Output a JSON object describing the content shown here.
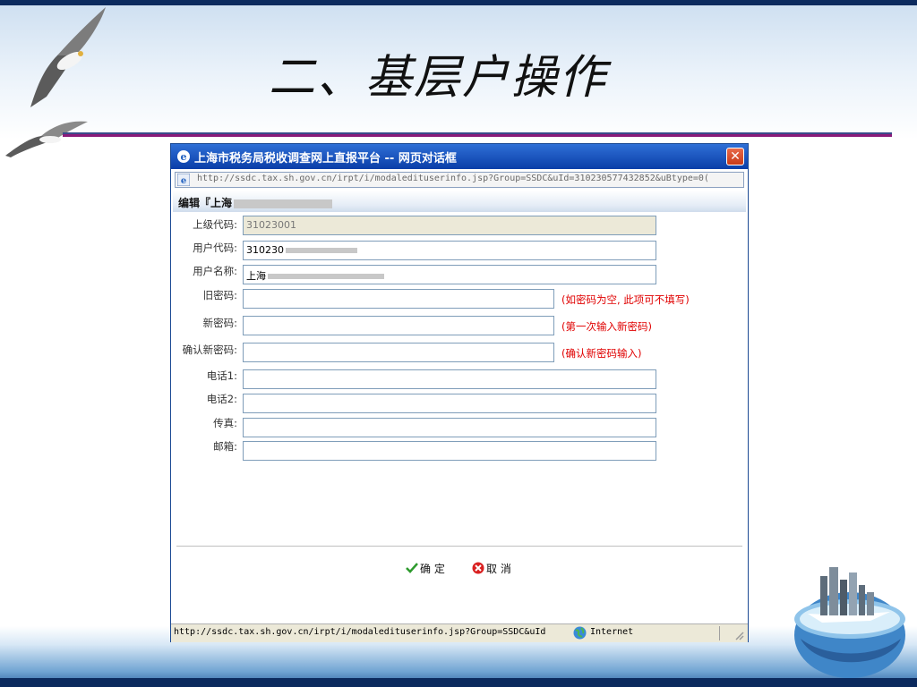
{
  "slide": {
    "title": "二、基层户操作"
  },
  "dialog": {
    "title": "上海市税务局税收调查网上直报平台 -- 网页对话框",
    "close_glyph": "✕",
    "address": "http://ssdc.tax.sh.gov.cn/irpt/i/modaledituserinfo.jsp?Group=SSDC&uId=310230577432852&uBtype=0(",
    "section_title": "编辑『上海",
    "fields": [
      {
        "label": "上级代码:",
        "value": "31023001",
        "readonly": true
      },
      {
        "label": "用户代码:",
        "value": "310230",
        "readonly": false
      },
      {
        "label": "用户名称:",
        "value": "上海",
        "readonly": false
      },
      {
        "label": "旧密码:",
        "value": "",
        "hint": "(如密码为空, 此项可不填写)"
      },
      {
        "label": "新密码:",
        "value": "",
        "hint": "(第一次输入新密码)"
      },
      {
        "label": "确认新密码:",
        "value": "",
        "hint": "(确认新密码输入)"
      },
      {
        "label": "电话1:",
        "value": ""
      },
      {
        "label": "电话2:",
        "value": ""
      },
      {
        "label": "传真:",
        "value": ""
      },
      {
        "label": "邮箱:",
        "value": ""
      }
    ],
    "buttons": {
      "ok_label": "确 定",
      "cancel_label": "取 消"
    },
    "status": {
      "url": "http://ssdc.tax.sh.gov.cn/irpt/i/modaledituserinfo.jsp?Group=SSDC&uId",
      "zone": "Internet"
    }
  },
  "colors": {
    "title_rule": "#8a1b7a",
    "titlebar": "#0a3ea8",
    "hint_red": "#e00000"
  }
}
